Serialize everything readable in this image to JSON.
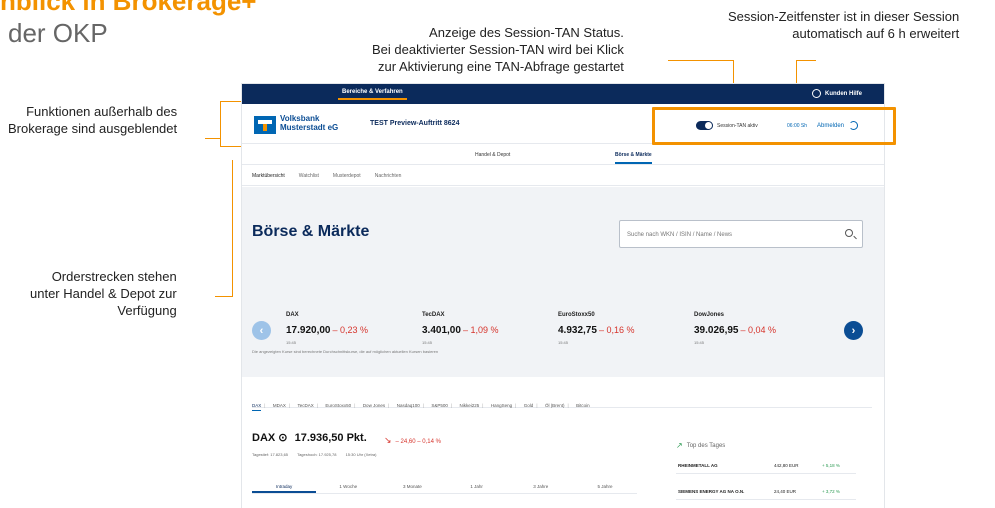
{
  "slide": {
    "title": "nblick in Brokerage+",
    "subtitle": "der OKP"
  },
  "callouts": {
    "tan": [
      "Anzeige des Session-TAN Status.",
      "Bei deaktivierter Session-TAN wird bei Klick",
      "zur Aktivierung eine TAN-Abfrage gestartet"
    ],
    "session": [
      "Session-Zeitfenster ist in dieser Session",
      "automatisch auf 6 h erweitert"
    ],
    "functions": [
      "Funktionen außerhalb des",
      "Brokerage sind ausgeblendet"
    ],
    "order": [
      "Orderstrecken stehen",
      "unter Handel & Depot zur",
      "Verfügung"
    ]
  },
  "app": {
    "topbar": {
      "active": "Bereiche & Verfahren",
      "kunden": "Kunden Hilfe"
    },
    "header": {
      "bank_line1": "Volksbank",
      "bank_line2": "Musterstadt eG",
      "preview": "TEST Preview-Auftritt 8624",
      "tan_status": "Session-TAN aktiv",
      "timer": "06:00 Sh",
      "logout": "Abmelden"
    },
    "mainnav": {
      "handel": "Handel & Depot",
      "boerse": "Börse & Märkte"
    },
    "subnav": [
      "Marktübersicht",
      "Watchlist",
      "Musterdepot",
      "Nachrichten"
    ],
    "hero": {
      "title": "Börse & Märkte",
      "search_placeholder": "Suche nach WKN / ISIN / Name / News",
      "note": "Die angezeigten Kurse sind berechnete Durchschnittskurse, die auf möglichen aktuellen Kursen basieren"
    },
    "indices": [
      {
        "name": "DAX",
        "value": "17.920,00",
        "change": "– 0,23 %",
        "time": "15:45"
      },
      {
        "name": "TecDAX",
        "value": "3.401,00",
        "change": "– 1,09 %",
        "time": "15:45"
      },
      {
        "name": "EuroStoxx50",
        "value": "4.932,75",
        "change": "– 0,16 %",
        "time": "15:45"
      },
      {
        "name": "DowJones",
        "value": "39.026,95",
        "change": "– 0,04 %",
        "time": "15:45"
      }
    ],
    "market_tabs": [
      "DAX",
      "MDAX",
      "TecDAX",
      "EuroStoxx50",
      "Dow Jones",
      "Nasdaq100",
      "S&P500",
      "Nikkei225",
      "HangSeng",
      "Gold",
      "Öl (Brent)",
      "Bitcoin"
    ],
    "dax": {
      "label": "DAX",
      "value": "17.936,50 Pkt.",
      "change": "– 24,60 – 0,14 %",
      "stats": [
        "Tagestief: 17.823,65",
        "Tageshoch: 17.925,78",
        "15:30 Uhr (Xetra)"
      ]
    },
    "period_tabs": [
      "Intraday",
      "1 Woche",
      "3 Monate",
      "1 Jahr",
      "3 Jahre",
      "5 Jahre"
    ],
    "top_day": {
      "title": "Top des Tages",
      "rows": [
        {
          "name": "RHEINMETALL AG",
          "price": "442,80 EUR",
          "change": "+ 5,18 %"
        },
        {
          "name": "SIEMENS ENERGY AG NA O.N.",
          "price": "24,40 EUR",
          "change": "+ 3,72 %"
        }
      ]
    }
  }
}
